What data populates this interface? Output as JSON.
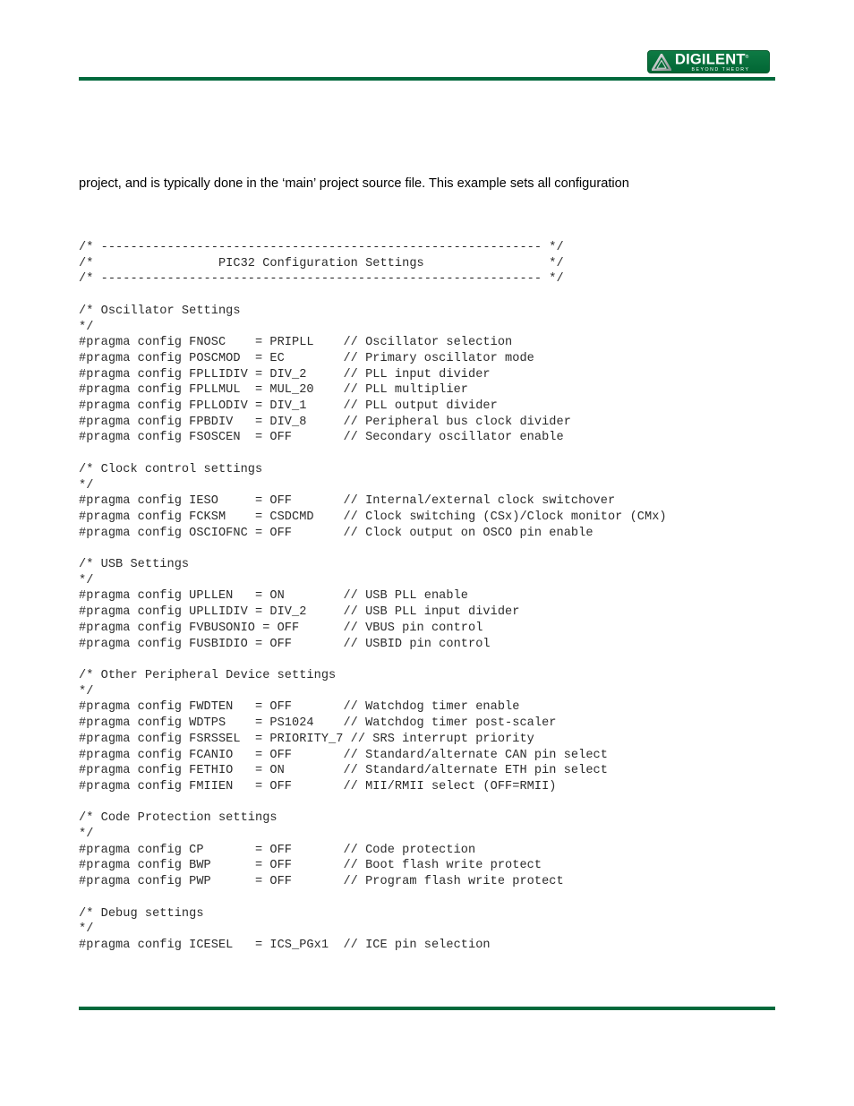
{
  "header": {
    "logo": {
      "wordmark": "DIGILENT",
      "tagline": "BEYOND THEORY",
      "trademark": "®",
      "mark_icon": "triangle-logo-icon",
      "background_color": "#016634",
      "text_color": "#ffffff"
    },
    "rule_color": "#00693c"
  },
  "content": {
    "paragraph": "project, and is typically done in the ‘main’ project source file. This example sets all configuration",
    "code_lines": [
      "/* ------------------------------------------------------------ */",
      "/*                 PIC32 Configuration Settings                 */",
      "/* ------------------------------------------------------------ */",
      "",
      "/* Oscillator Settings",
      "*/",
      "#pragma config FNOSC    = PRIPLL    // Oscillator selection",
      "#pragma config POSCMOD  = EC        // Primary oscillator mode",
      "#pragma config FPLLIDIV = DIV_2     // PLL input divider",
      "#pragma config FPLLMUL  = MUL_20    // PLL multiplier",
      "#pragma config FPLLODIV = DIV_1     // PLL output divider",
      "#pragma config FPBDIV   = DIV_8     // Peripheral bus clock divider",
      "#pragma config FSOSCEN  = OFF       // Secondary oscillator enable",
      "",
      "/* Clock control settings",
      "*/",
      "#pragma config IESO     = OFF       // Internal/external clock switchover",
      "#pragma config FCKSM    = CSDCMD    // Clock switching (CSx)/Clock monitor (CMx)",
      "#pragma config OSCIOFNC = OFF       // Clock output on OSCO pin enable",
      "",
      "/* USB Settings",
      "*/",
      "#pragma config UPLLEN   = ON        // USB PLL enable",
      "#pragma config UPLLIDIV = DIV_2     // USB PLL input divider",
      "#pragma config FVBUSONIO = OFF      // VBUS pin control",
      "#pragma config FUSBIDIO = OFF       // USBID pin control",
      "",
      "/* Other Peripheral Device settings",
      "*/",
      "#pragma config FWDTEN   = OFF       // Watchdog timer enable",
      "#pragma config WDTPS    = PS1024    // Watchdog timer post-scaler",
      "#pragma config FSRSSEL  = PRIORITY_7 // SRS interrupt priority",
      "#pragma config FCANIO   = OFF       // Standard/alternate CAN pin select",
      "#pragma config FETHIO   = ON        // Standard/alternate ETH pin select",
      "#pragma config FMIIEN   = OFF       // MII/RMII select (OFF=RMII)",
      "",
      "/* Code Protection settings",
      "*/",
      "#pragma config CP       = OFF       // Code protection",
      "#pragma config BWP      = OFF       // Boot flash write protect",
      "#pragma config PWP      = OFF       // Program flash write protect",
      "",
      "/* Debug settings",
      "*/",
      "#pragma config ICESEL   = ICS_PGx1  // ICE pin selection"
    ]
  },
  "footer": {
    "rule_color": "#00693c"
  }
}
